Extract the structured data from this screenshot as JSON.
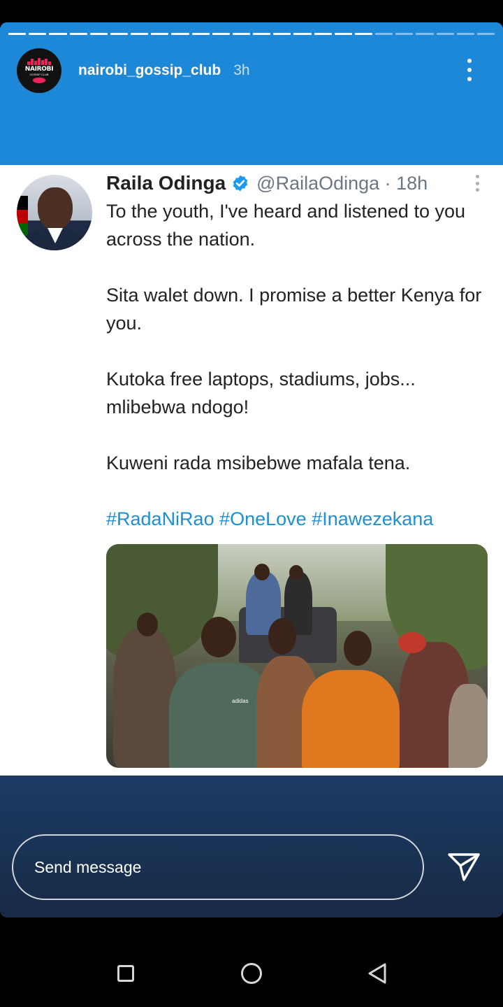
{
  "story": {
    "username": "nairobi_gossip_club",
    "time": "3h",
    "logo_text": "NAIROBI",
    "logo_subtext": "GOSSIP CLUB",
    "progress_segments_total": 24,
    "progress_segments_done": 18
  },
  "tweet": {
    "name": "Raila Odinga",
    "handle": "@RailaOdinga · 18h",
    "paragraphs": [
      "To the youth, I've heard and  listened to you across the nation.",
      "Sita walet down. I promise a better Kenya for you.",
      "Kutoka free laptops, stadiums, jobs... mlibebwa ndogo!",
      "Kuweni rada msibebwe mafala tena."
    ],
    "hashtags": "#RadaNiRao #OneLove #Inawezekana",
    "photo_text": "adidas"
  },
  "reply": {
    "placeholder": "Send message"
  },
  "icons": {
    "more": "more-vertical-icon",
    "verified": "verified-badge-icon",
    "send": "send-icon",
    "nav": [
      "recents-icon",
      "home-icon",
      "back-icon"
    ]
  },
  "colors": {
    "story_top": "#1e88d8",
    "story_bottom": "#182a45",
    "brand_pink": "#e8245b",
    "verified_blue": "#1d9bf0",
    "hashtag_blue": "#1c8fd7"
  }
}
